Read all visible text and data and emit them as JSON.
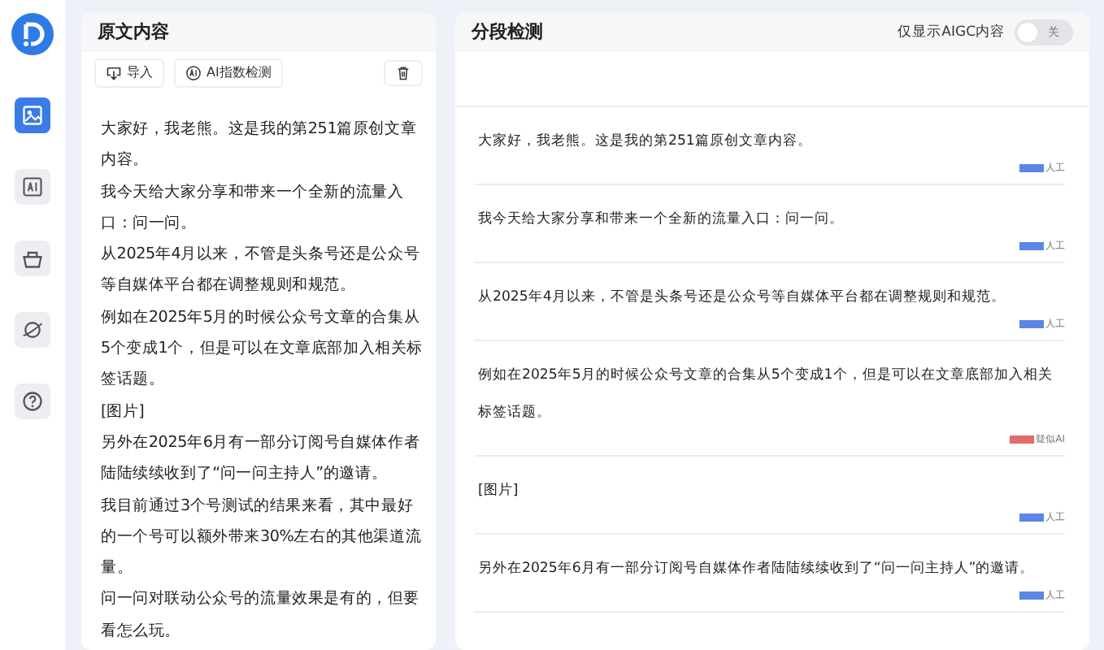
{
  "sidebar": {
    "items": [
      {
        "kind": "image",
        "selected": true
      },
      {
        "kind": "ai",
        "selected": false
      },
      {
        "kind": "basket",
        "selected": false
      },
      {
        "kind": "planet",
        "selected": false
      },
      {
        "kind": "help",
        "selected": false
      }
    ]
  },
  "source_panel": {
    "title": "原文内容",
    "toolbar": [
      {
        "kind": "import",
        "label": "导入"
      },
      {
        "kind": "ai",
        "label": "AI指数检测"
      },
      {
        "kind": "delete"
      }
    ],
    "paragraphs": [
      "大家好，我老熊。这是我的第251篇原创文章内容。",
      "我今天给大家分享和带来一个全新的流量入口：问一问。",
      "从2025年4月以来，不管是头条号还是公众号等自媒体平台都在调整规则和规范。",
      "例如在2025年5月的时候公众号文章的合集从5个变成1个，但是可以在文章底部加入相关标签话题。",
      "[图片]",
      "另外在2025年6月有一部分订阅号自媒体作者陆陆续续收到了“问一问主持人”的邀请。",
      "我目前通过3个号测试的结果来看，其中最好的一个号可以额外带来30%左右的其他渠道流量。",
      "问一问对联动公众号的流量效果是有的，但要看怎么玩。"
    ]
  },
  "segments_panel": {
    "title": "分段检测",
    "filter": {
      "label": "仅显示AIGC内容",
      "on": false,
      "state_label": "关"
    },
    "segments": [
      {
        "text": "大家好，我老熊。这是我的第251篇原创文章内容。",
        "tag": "人工",
        "color": "#5b86e5"
      },
      {
        "text": "我今天给大家分享和带来一个全新的流量入口：问一问。",
        "tag": "人工",
        "color": "#5b86e5"
      },
      {
        "text": "从2025年4月以来，不管是头条号还是公众号等自媒体平台都在调整规则和规范。",
        "tag": "人工",
        "color": "#5b86e5"
      },
      {
        "text": "例如在2025年5月的时候公众号文章的合集从5个变成1个，但是可以在文章底部加入相关标签话题。",
        "tag": "疑似AI",
        "color": "#e06c6c"
      },
      {
        "text": "[图片]",
        "tag": "人工",
        "color": "#5b86e5"
      },
      {
        "text": "另外在2025年6月有一部分订阅号自媒体作者陆陆续续收到了“问一问主持人”的邀请。",
        "tag": "人工",
        "color": "#5b86e5"
      }
    ]
  }
}
